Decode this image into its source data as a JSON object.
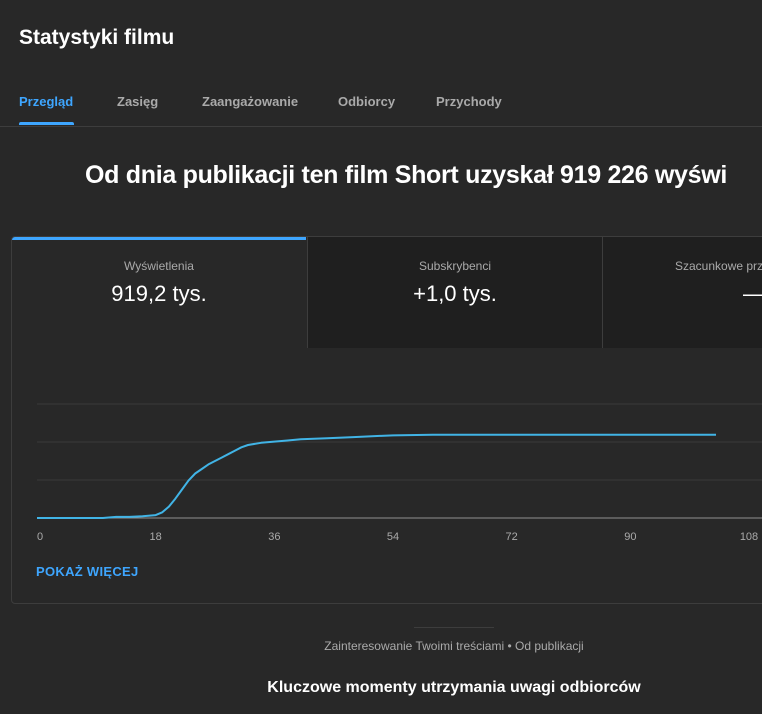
{
  "header": {
    "title": "Statystyki filmu"
  },
  "tabs": [
    {
      "label": "Przegląd",
      "active": true
    },
    {
      "label": "Zasięg",
      "active": false
    },
    {
      "label": "Zaangażowanie",
      "active": false
    },
    {
      "label": "Odbiorcy",
      "active": false
    },
    {
      "label": "Przychody",
      "active": false
    }
  ],
  "headline": "Od dnia publikacji ten film Short uzyskał 919 226 wyświ",
  "metrics": [
    {
      "label": "Wyświetlenia",
      "value": "919,2 tys.",
      "active": true
    },
    {
      "label": "Subskrybenci",
      "value": "+1,0 tys.",
      "active": false
    },
    {
      "label": "Szacunkowe prz",
      "value": "—",
      "active": false
    }
  ],
  "show_more_label": "POKAŻ WIĘCEJ",
  "footer": {
    "subtitle": "Zainteresowanie Twoimi treściami • Od publikacji",
    "section_title": "Kluczowe momenty utrzymania uwagi odbiorców"
  },
  "colors": {
    "accent": "#3ea6ff",
    "line": "#41b4e6",
    "background": "#282828"
  },
  "chart_data": {
    "type": "line",
    "x_ticks": [
      "0",
      "18",
      "36",
      "54",
      "72",
      "90",
      "108"
    ],
    "xlim": [
      0,
      108
    ],
    "ylim": [
      0,
      1
    ],
    "grid": true,
    "series": [
      {
        "x": [
          0,
          6,
          10,
          12,
          14,
          16,
          18,
          19,
          20,
          21,
          22,
          23,
          24,
          25,
          26,
          27,
          28,
          29,
          30,
          31,
          32,
          34,
          36,
          38,
          40,
          44,
          48,
          52,
          54,
          60,
          70,
          80,
          90,
          100,
          103
        ],
        "y": [
          0.0,
          0.0,
          0.0,
          0.01,
          0.01,
          0.015,
          0.025,
          0.05,
          0.1,
          0.17,
          0.25,
          0.33,
          0.39,
          0.43,
          0.47,
          0.5,
          0.53,
          0.56,
          0.59,
          0.62,
          0.64,
          0.66,
          0.67,
          0.68,
          0.69,
          0.7,
          0.71,
          0.72,
          0.725,
          0.73,
          0.73,
          0.73,
          0.73,
          0.73,
          0.73
        ]
      }
    ]
  }
}
